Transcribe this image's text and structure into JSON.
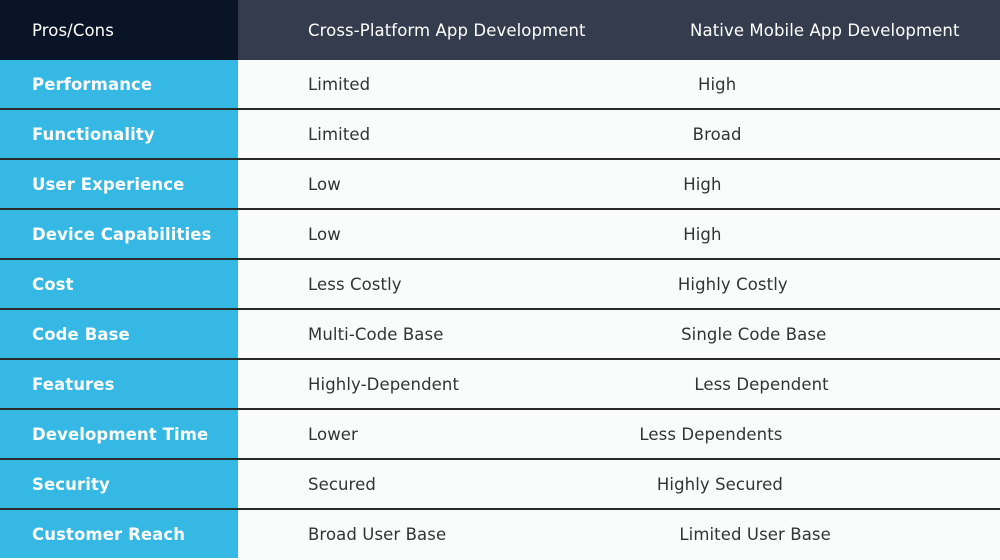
{
  "table": {
    "columns": [
      {
        "key": "criterion",
        "label": "Pros/Cons"
      },
      {
        "key": "cross_platform",
        "label": "Cross-Platform App Development"
      },
      {
        "key": "native",
        "label": "Native Mobile App Development"
      }
    ],
    "rows": [
      {
        "criterion": "Performance",
        "cross_platform": "Limited",
        "native": "High"
      },
      {
        "criterion": "Functionality",
        "cross_platform": "Limited",
        "native": "Broad"
      },
      {
        "criterion": "User Experience",
        "cross_platform": "Low",
        "native": "High"
      },
      {
        "criterion": "Device Capabilities",
        "cross_platform": "Low",
        "native": "High"
      },
      {
        "criterion": "Cost",
        "cross_platform": "Less Costly",
        "native": "Highly Costly"
      },
      {
        "criterion": "Code Base",
        "cross_platform": "Multi-Code Base",
        "native": "Single Code Base"
      },
      {
        "criterion": "Features",
        "cross_platform": "Highly-Dependent",
        "native": "Less Dependent"
      },
      {
        "criterion": "Development Time",
        "cross_platform": "Lower",
        "native": "Less Dependents"
      },
      {
        "criterion": "Security",
        "cross_platform": "Secured",
        "native": "Highly Secured"
      },
      {
        "criterion": "Customer Reach",
        "cross_platform": "Broad User Base",
        "native": "Limited User Base"
      }
    ]
  },
  "colors": {
    "header_corner_bg": "#091426",
    "header_bg": "#343c4e",
    "header_text": "#ffffff",
    "label_column_bg": "#35b8e3",
    "label_column_text": "#ffffff",
    "body_bg": "#fafbfb",
    "body_text": "#333333",
    "row_divider": "#2b2b2b"
  }
}
